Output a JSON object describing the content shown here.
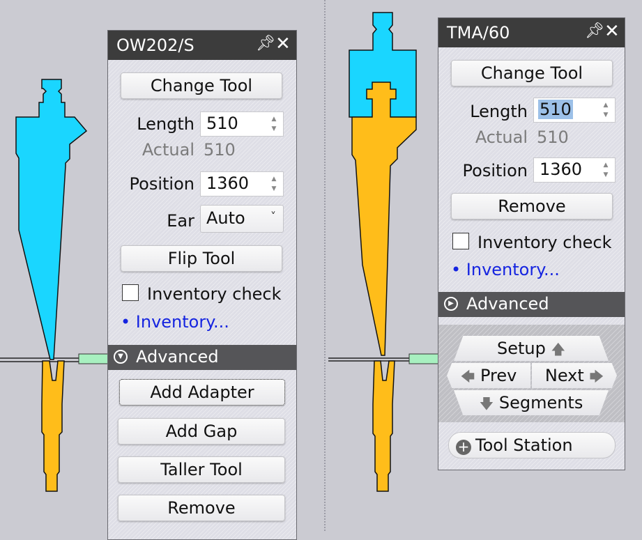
{
  "left_panel": {
    "title": "OW202/S",
    "change_tool": "Change Tool",
    "length_label": "Length",
    "length_value": "510",
    "actual_label": "Actual",
    "actual_value": "510",
    "position_label": "Position",
    "position_value": "1360",
    "ear_label": "Ear",
    "ear_value": "Auto",
    "flip_tool": "Flip Tool",
    "inventory_check": "Inventory check",
    "inventory_link": "• Inventory...",
    "advanced_label": "Advanced",
    "add_adapter": "Add Adapter",
    "add_gap": "Add Gap",
    "taller_tool": "Taller Tool",
    "remove": "Remove"
  },
  "right_panel": {
    "title": "TMA/60",
    "change_tool": "Change Tool",
    "length_label": "Length",
    "length_value": "510",
    "actual_label": "Actual",
    "actual_value": "510",
    "position_label": "Position",
    "position_value": "1360",
    "remove": "Remove",
    "inventory_check": "Inventory check",
    "inventory_link": "• Inventory...",
    "advanced_label": "Advanced",
    "nav": {
      "setup": "Setup",
      "prev": "Prev",
      "next": "Next",
      "segments": "Segments"
    },
    "tool_station": "Tool Station"
  },
  "colors": {
    "punch_blue": "#1ad6ff",
    "die_yellow": "#ffbd1a",
    "sheet_green": "#a8f0c0",
    "header_dark": "#3c3c3c",
    "link_blue": "#1524e0"
  },
  "icons": {
    "pin": "pin-icon",
    "close": "close-icon",
    "advanced_left": "chevron-circle-down-icon",
    "advanced_right": "chevron-circle-right-icon",
    "tool_station": "plus-circle-icon"
  }
}
